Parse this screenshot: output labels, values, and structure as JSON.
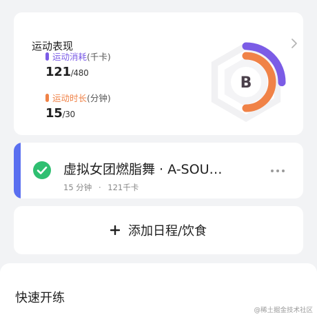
{
  "performance": {
    "title": "运动表现",
    "grade": "B",
    "calories": {
      "label": "运动消耗",
      "unit": "(千卡)",
      "value": "121",
      "goal": "/480",
      "progress": 0.252,
      "color": "#7b5ce6"
    },
    "duration": {
      "label": "运动时长",
      "unit": "(分钟)",
      "value": "15",
      "goal": "/30",
      "progress": 0.5,
      "color": "#f08247"
    }
  },
  "workout": {
    "title": "虚拟女团燃脂舞 · A-SOU…",
    "duration": "15 分钟",
    "separator": "·",
    "calories": "121千卡",
    "accent_color": "#5a6ff0",
    "check_color": "#2fbf71"
  },
  "add": {
    "label": "添加日程/饮食"
  },
  "quick": {
    "title": "快速开练"
  },
  "watermark": "@稀土掘金技术社区"
}
